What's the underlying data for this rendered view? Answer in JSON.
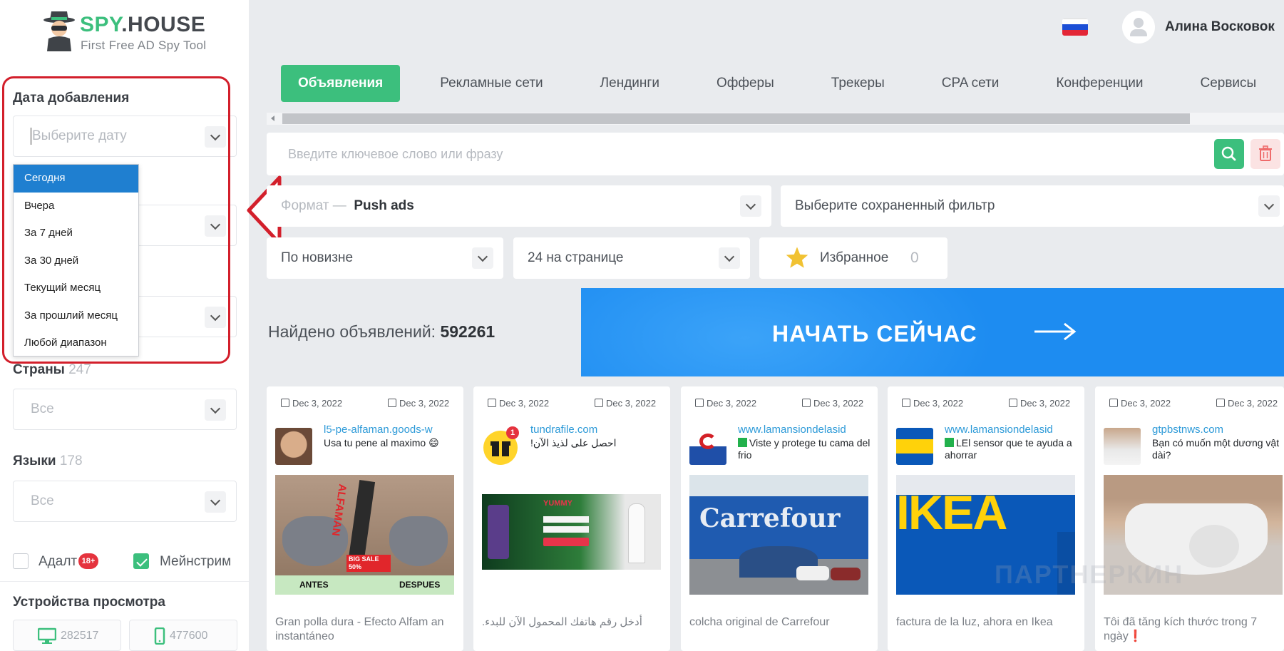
{
  "logo": {
    "brand_a": "SPY",
    "brand_b": ".HOUSE",
    "tagline": "First Free AD Spy Tool"
  },
  "filters": {
    "date_label": "Дата добавления",
    "date_placeholder": "Выберите дату",
    "date_options": [
      "Сегодня",
      "Вчера",
      "За 7 дней",
      "За 30 дней",
      "Текущий месяц",
      "За прошлий месяц",
      "Любой диапазон"
    ],
    "countries_label": "Страны",
    "countries_count": "247",
    "countries_value": "Все",
    "languages_label": "Языки",
    "languages_count": "178",
    "languages_value": "Все",
    "adult_label": "Адалт",
    "adult_badge": "18+",
    "mainstream_label": "Мейнстрим",
    "adult_checked": false,
    "mainstream_checked": true,
    "devices_label": "Устройства просмотра",
    "desktop_count": "282517",
    "mobile_count": "477600"
  },
  "header": {
    "username": "Алина Восковок",
    "tabs": [
      "Объявления",
      "Рекламные сети",
      "Лендинги",
      "Офферы",
      "Трекеры",
      "CPA сети",
      "Конференции",
      "Сервисы"
    ],
    "active_tab": 0
  },
  "search": {
    "placeholder": "Введите ключевое слово или фразу"
  },
  "toolbar": {
    "format_label": "Формат —",
    "format_value": "Push ads",
    "saved_filter_placeholder": "Выберите сохраненный фильтр",
    "sort_value": "По новизне",
    "per_page_value": "24 на странице",
    "favorites_label": "Избранное",
    "favorites_count": "0"
  },
  "results": {
    "found_label": "Найдено объявлений:",
    "found_count": "592261"
  },
  "banner": {
    "cta": "НАЧАТЬ СЕЙЧАС"
  },
  "cards": [
    {
      "date_created": "Dec 3, 2022",
      "date_seen": "Dec 3, 2022",
      "domain": "l5-pe-alfaman.goods-w",
      "headline": "Usa tu pene al maximo 😄",
      "description": "Gran polla dura - Efecto Alfam an instantáneo",
      "creative_labels": [
        "ALFAMAN",
        "BIG SALE 50%",
        "ANTES",
        "DESPUES"
      ]
    },
    {
      "date_created": "Dec 3, 2022",
      "date_seen": "Dec 3, 2022",
      "domain": "tundrafile.com",
      "headline": "احصل على لذيذ الآن!",
      "description": "أدخل رقم هاتفك المحمول الآن للبدء.",
      "creative_labels": [
        "YUMMY"
      ],
      "badge": "1"
    },
    {
      "date_created": "Dec 3, 2022",
      "date_seen": "Dec 3, 2022",
      "domain": "www.lamansiondelasid",
      "headline": "Viste y protege tu cama del frio",
      "description": "colcha original de Carrefour",
      "creative_labels": [
        "Carrefour"
      ]
    },
    {
      "date_created": "Dec 3, 2022",
      "date_seen": "Dec 3, 2022",
      "domain": "www.lamansiondelasid",
      "headline": "LEl sensor que te ayuda a ahorrar",
      "description": "factura de la luz, ahora en Ikea",
      "creative_labels": [
        "IKEA"
      ]
    },
    {
      "date_created": "Dec 3, 2022",
      "date_seen": "Dec 3, 2022",
      "domain": "gtpbstnws.com",
      "headline": "Bạn có muốn một dương vật dài?",
      "description": "Tôi đã tăng kích thước trong 7 ngày❗",
      "creative_labels": []
    }
  ],
  "watermark": "ПАРТНЕРКИН",
  "colors": {
    "accent": "#3cbf7d",
    "highlight": "#d31f2b",
    "link": "#2d9ad8",
    "banner": "#1d8cf1"
  }
}
